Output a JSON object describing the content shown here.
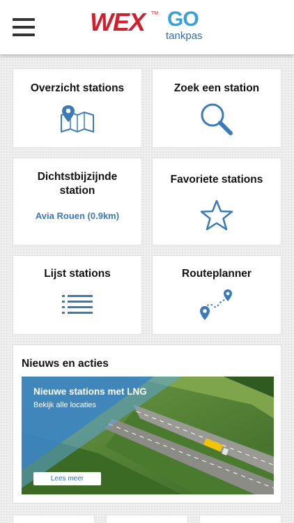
{
  "header": {
    "brand_wex": "WEX",
    "brand_tm": "TM",
    "brand_go": "GO",
    "brand_tankpas": "tankpas",
    "menu_icon": "hamburger-menu-icon"
  },
  "tiles": [
    {
      "title": "Overzicht stations",
      "icon": "map-pin-icon"
    },
    {
      "title": "Zoek een station",
      "icon": "search-icon"
    },
    {
      "title": "Dichtstbijzijnde station",
      "subtitle": "Avia Rouen (0.9km)"
    },
    {
      "title": "Favoriete stations",
      "icon": "star-icon"
    },
    {
      "title": "Lijst stations",
      "icon": "list-icon"
    },
    {
      "title": "Routeplanner",
      "icon": "route-icon"
    }
  ],
  "news": {
    "title": "Nieuws en acties",
    "banner_title": "Nieuwe stations met LNG",
    "banner_subtitle": "Bekijk alle locaties",
    "banner_button": "Lees meer"
  },
  "colors": {
    "accent_blue": "#3a7ab8",
    "wex_red": "#d0202e",
    "go_blue": "#3aa0d8"
  }
}
